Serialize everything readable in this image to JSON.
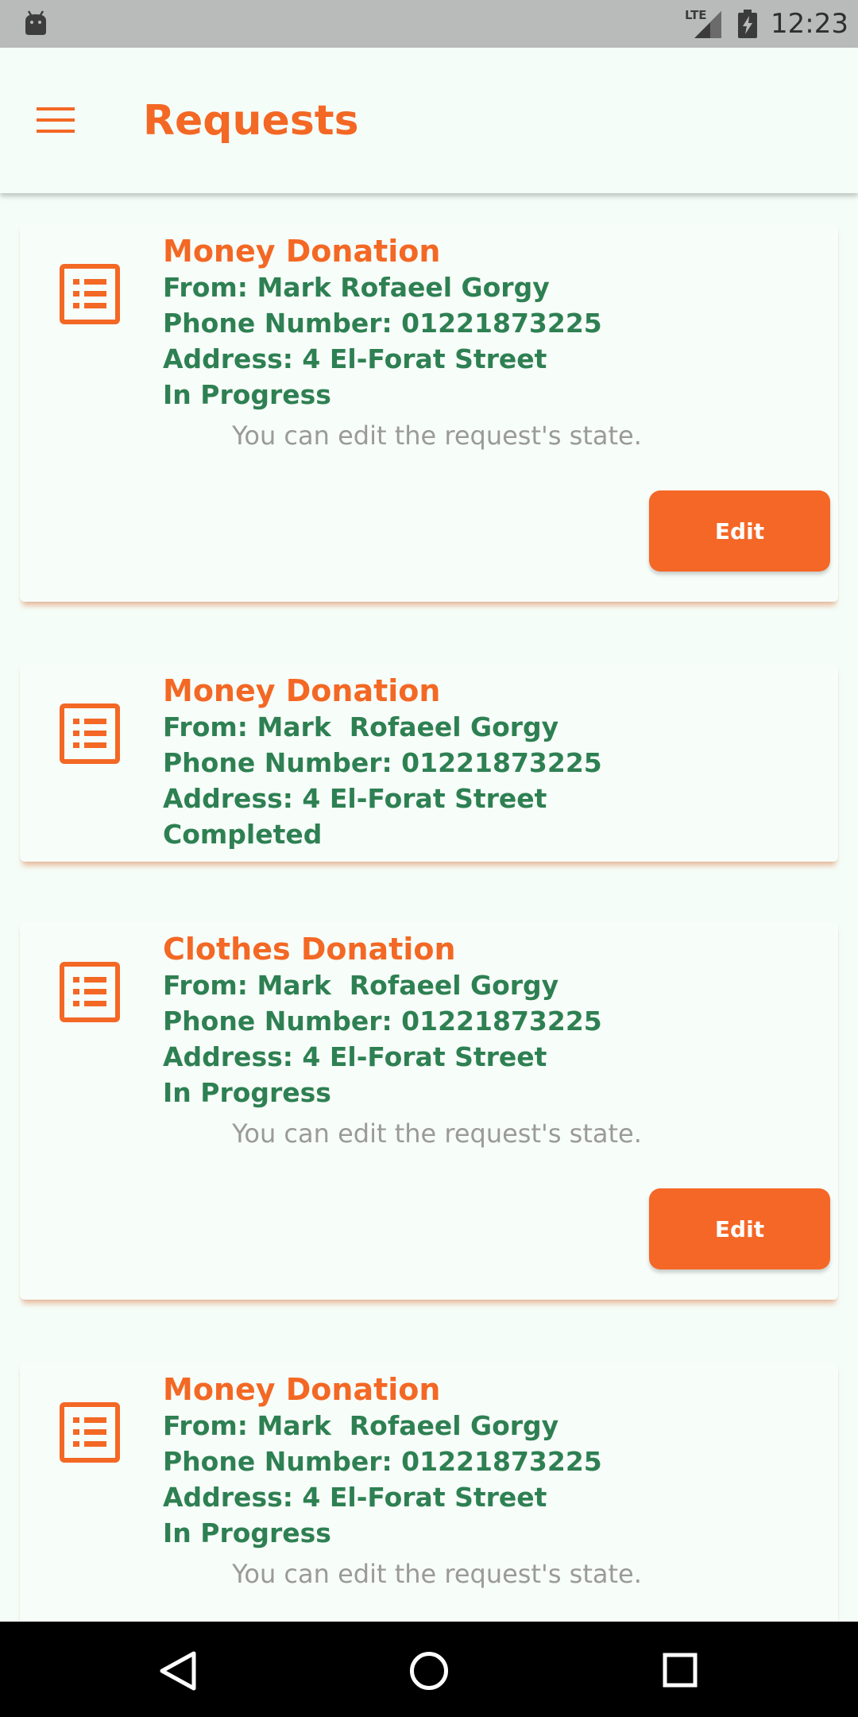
{
  "status_bar": {
    "time": "12:23",
    "network": "LTE",
    "icons": [
      "android-icon",
      "signal-icon",
      "battery-icon"
    ]
  },
  "app_bar": {
    "title": "Requests",
    "menu_icon": "menu-icon"
  },
  "requests": [
    {
      "title": "Money Donation",
      "from": "From: Mark Rofaeel Gorgy",
      "phone": "Phone Number: 01221873225",
      "address": "Address: 4 El-Forat Street",
      "status": "In Progress",
      "hint": "You can edit the request's state.",
      "button": "Edit"
    },
    {
      "title": "Money Donation",
      "from": "From: Mark  Rofaeel Gorgy",
      "phone": "Phone Number: 01221873225",
      "address": "Address: 4 El-Forat Street",
      "status": "Completed"
    },
    {
      "title": "Clothes Donation",
      "from": "From: Mark  Rofaeel Gorgy",
      "phone": "Phone Number: 01221873225",
      "address": "Address: 4 El-Forat Street",
      "status": "In Progress",
      "hint": "You can edit the request's state.",
      "button": "Edit"
    },
    {
      "title": "Money Donation",
      "from": "From: Mark  Rofaeel Gorgy",
      "phone": "Phone Number: 01221873225",
      "address": "Address: 4 El-Forat Street",
      "status": "In Progress",
      "hint": "You can edit the request's state."
    }
  ],
  "colors": {
    "accent": "#f36824",
    "detail_text": "#2e8052",
    "hint_text": "#9a9a9a",
    "background": "#f5fdf8"
  },
  "nav_bar": {
    "icons": [
      "back-icon",
      "home-icon",
      "recents-icon"
    ]
  }
}
